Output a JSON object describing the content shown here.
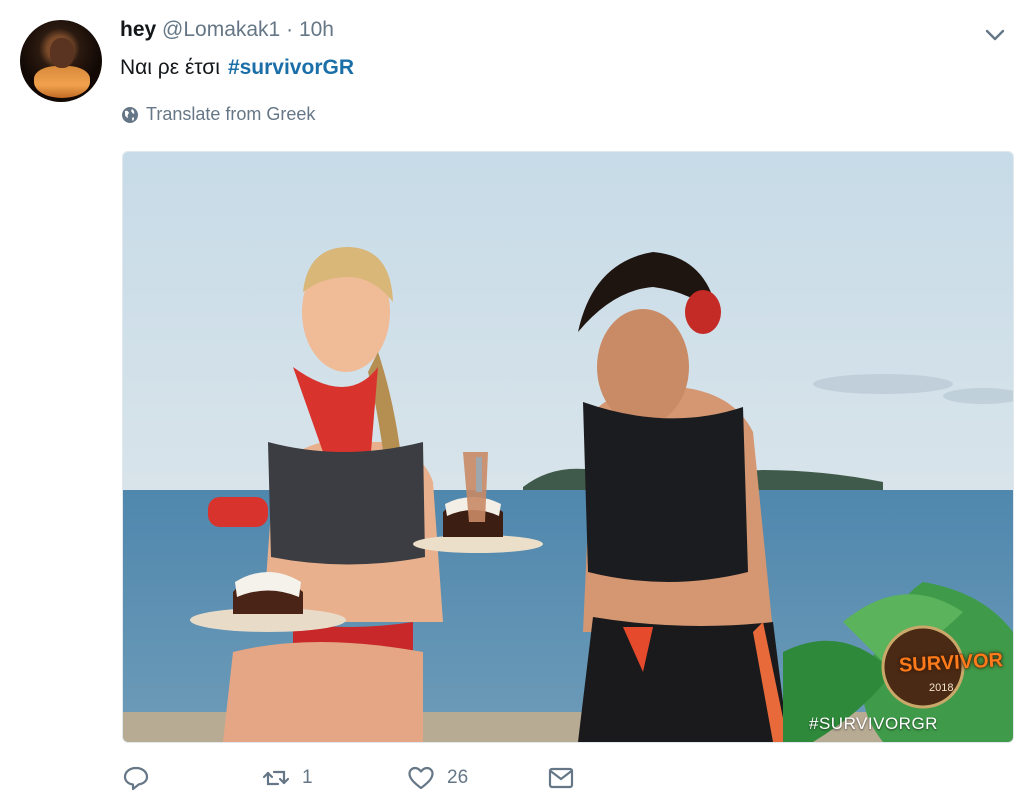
{
  "tweet": {
    "display_name": "hey",
    "handle": "@Lomakak1",
    "separator": "·",
    "time": "10h",
    "text": "Ναι ρε έτσι",
    "hashtag": "#survivorGR",
    "translate_label": "Translate from Greek"
  },
  "media": {
    "watermark_hashtag": "#SURVIVORGR",
    "logo_text": "SURVIVOR",
    "logo_year": "2018"
  },
  "actions": {
    "reply_count": "",
    "retweet_count": "1",
    "like_count": "26"
  },
  "icons": [
    "avatar",
    "chevron-down-icon",
    "globe-icon",
    "reply-icon",
    "retweet-icon",
    "like-icon",
    "message-icon"
  ]
}
